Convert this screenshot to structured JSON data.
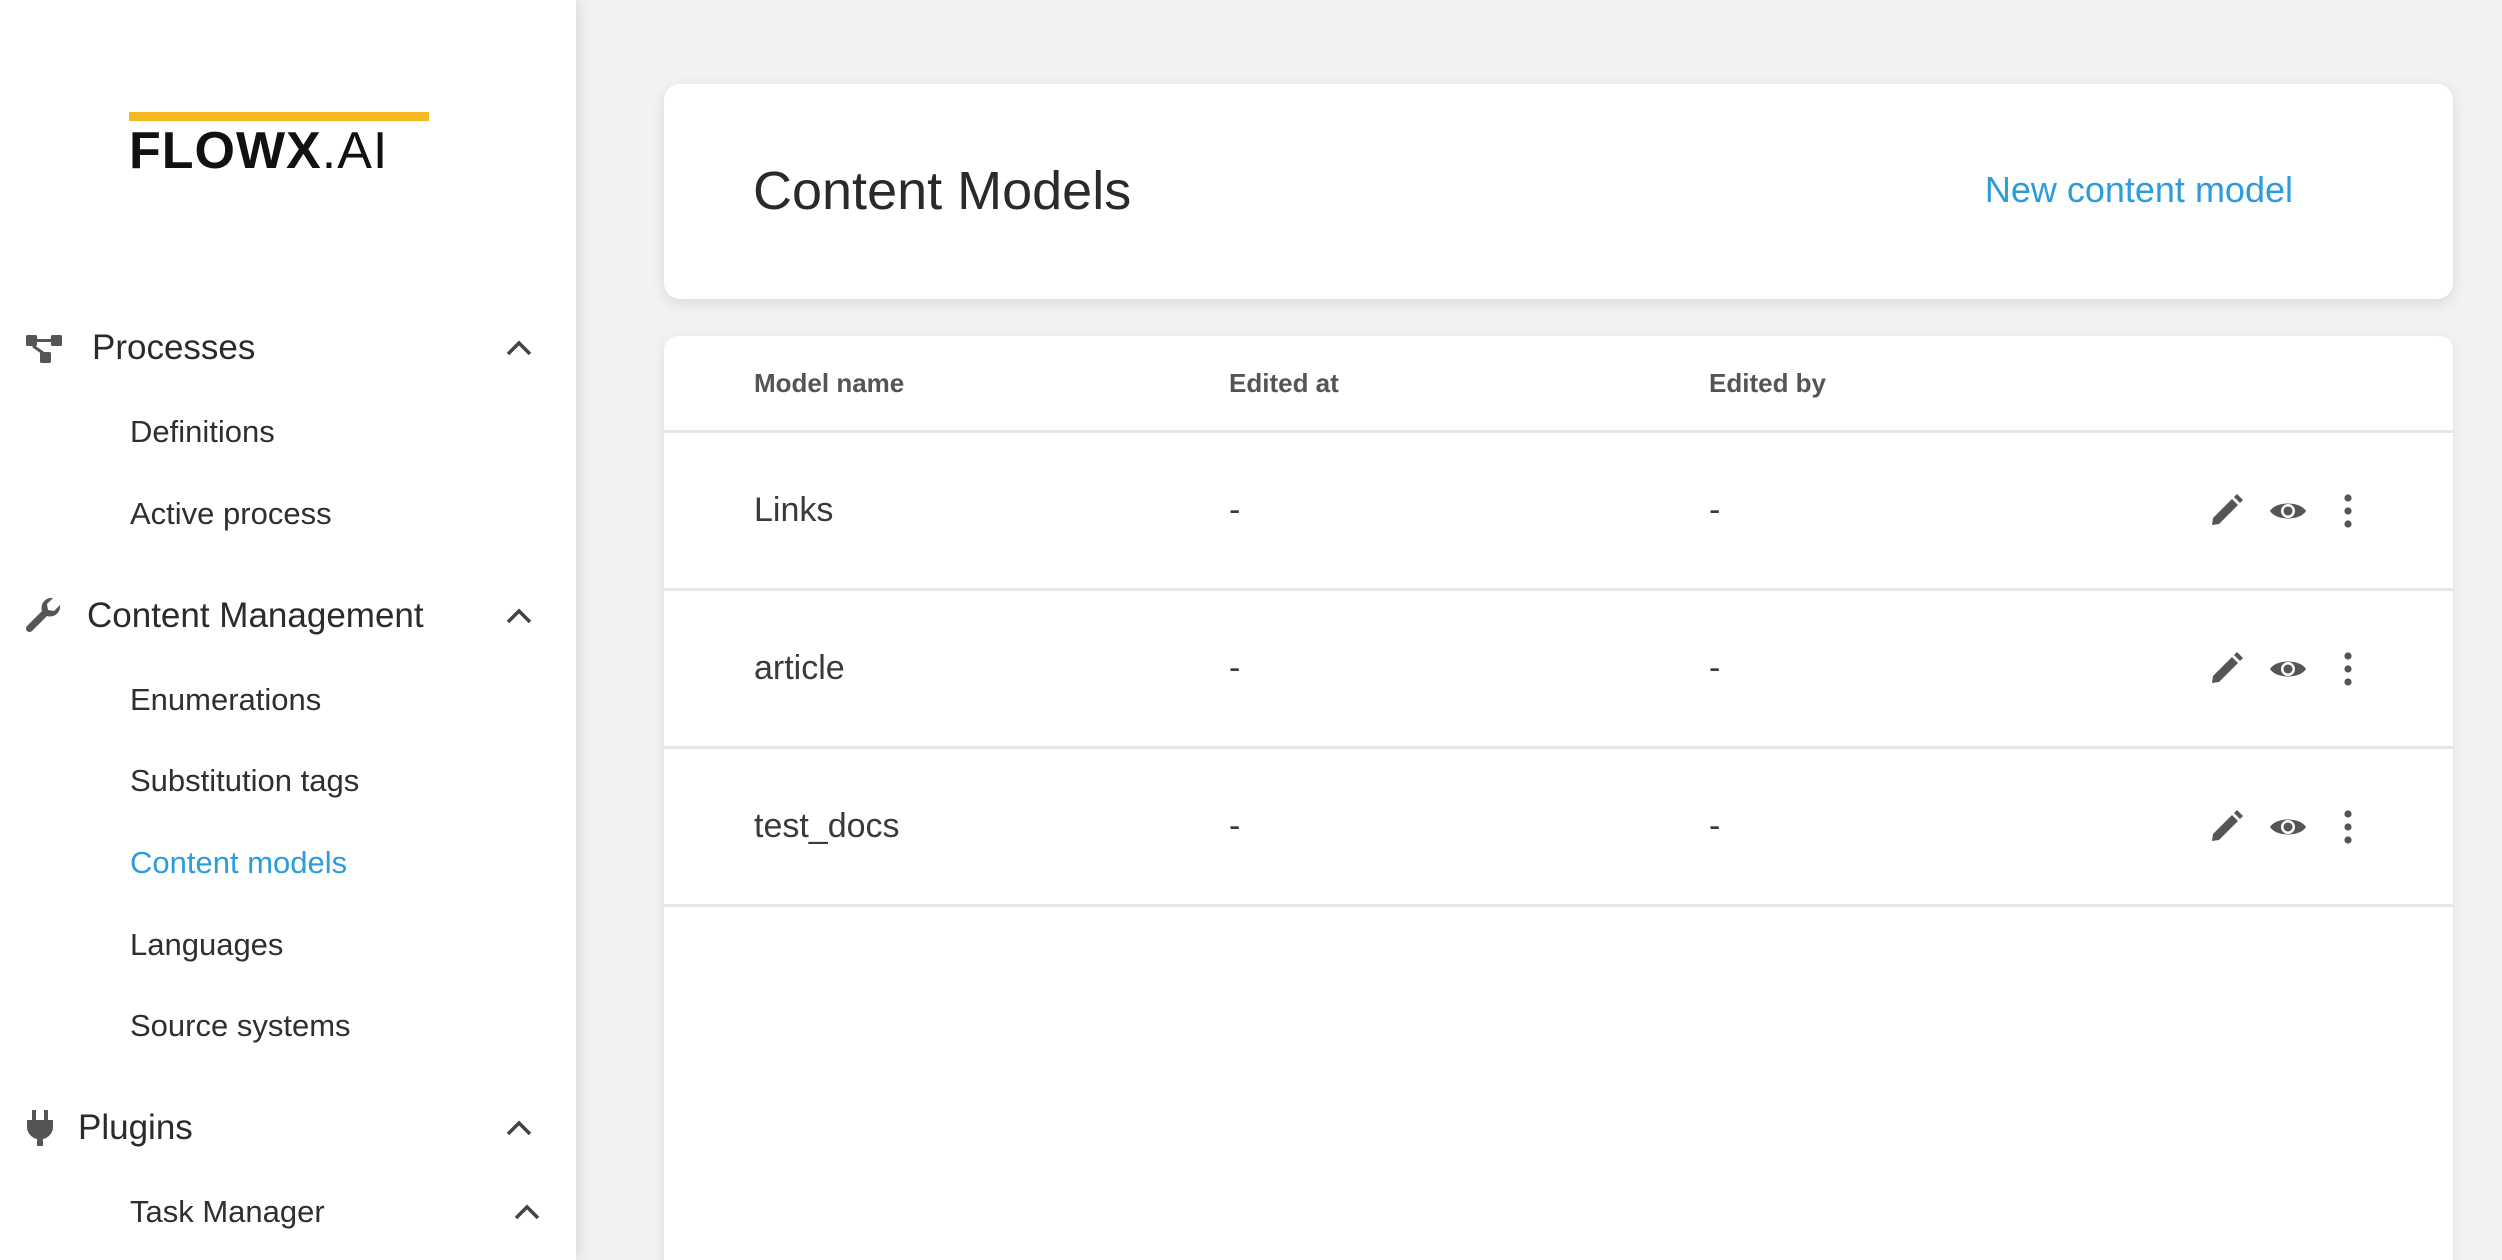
{
  "logo": {
    "strong": "FLOWX",
    "light": ".AI"
  },
  "sidebar": {
    "sections": [
      {
        "label": "Processes",
        "icon": "process-flow-icon",
        "items": [
          "Definitions",
          "Active process"
        ]
      },
      {
        "label": "Content Management",
        "icon": "wrench-icon",
        "items": [
          "Enumerations",
          "Substitution tags",
          "Content models",
          "Languages",
          "Source systems"
        ],
        "active": "Content models"
      },
      {
        "label": "Plugins",
        "icon": "plug-icon",
        "items": [
          "Task Manager"
        ]
      }
    ]
  },
  "header": {
    "title": "Content Models",
    "new_button": "New content model"
  },
  "table": {
    "columns": [
      "Model name",
      "Edited at",
      "Edited by"
    ],
    "rows": [
      {
        "name": "Links",
        "edited_at": "-",
        "edited_by": "-"
      },
      {
        "name": "article",
        "edited_at": "-",
        "edited_by": "-"
      },
      {
        "name": "test_docs",
        "edited_at": "-",
        "edited_by": "-"
      }
    ],
    "actions": [
      "edit-icon",
      "view-icon",
      "more-icon"
    ]
  },
  "colors": {
    "accent": "#2d9cdb",
    "logo_bar": "#f7b81f",
    "background": "#f2f2f2"
  }
}
